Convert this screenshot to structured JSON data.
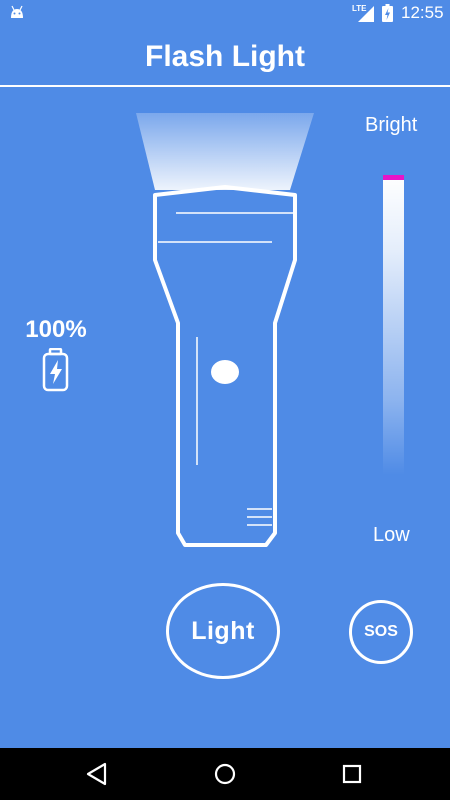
{
  "status_bar": {
    "network": "LTE",
    "time": "12:55",
    "icons": [
      "android-icon",
      "signal-icon",
      "battery-charging-icon"
    ]
  },
  "app": {
    "title": "Flash Light"
  },
  "battery": {
    "percent_text": "100%",
    "icon": "battery-charging-icon"
  },
  "brightness": {
    "top_label": "Bright",
    "bottom_label": "Low",
    "level": 1.0,
    "thumb_color": "#E814C8"
  },
  "controls": {
    "light_label": "Light",
    "sos_label": "SOS"
  },
  "nav": {
    "icons": [
      "back-icon",
      "home-icon",
      "recents-icon"
    ]
  },
  "colors": {
    "background": "#4F8BE6",
    "foreground": "#FFFFFF",
    "nav_background": "#000000"
  }
}
